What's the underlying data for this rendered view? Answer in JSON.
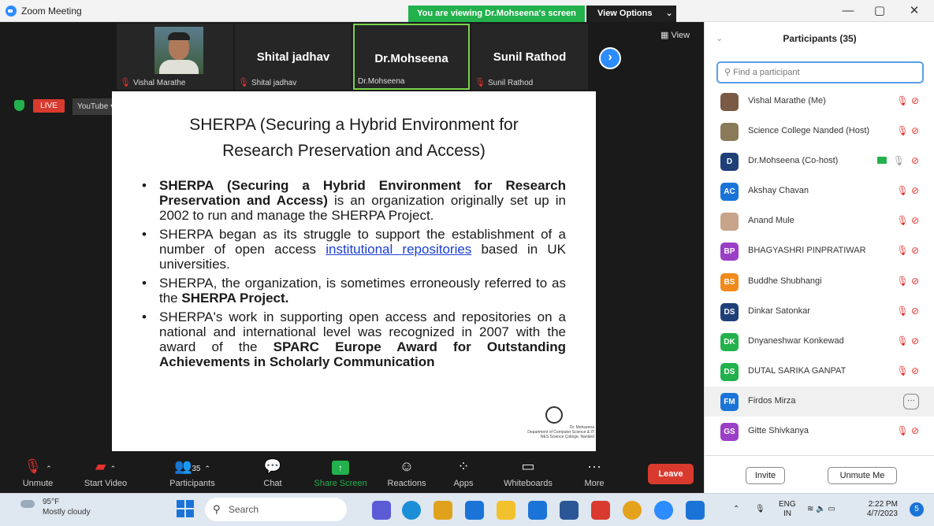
{
  "window": {
    "title": "Zoom Meeting",
    "minimize": "—",
    "maximize": "▢",
    "close": "✕"
  },
  "banner": {
    "viewing": "You are viewing Dr.Mohseena's screen",
    "view_options": "View Options"
  },
  "gallery": {
    "view_label": "View",
    "thumbs": [
      {
        "big_name": "",
        "label": "Vishal Marathe"
      },
      {
        "big_name": "Shital jadhav",
        "label": "Shital jadhav"
      },
      {
        "big_name": "Dr.Mohseena",
        "label": "Dr.Mohseena"
      },
      {
        "big_name": "Sunil Rathod",
        "label": "Sunil Rathod"
      }
    ]
  },
  "stream": {
    "live": "LIVE",
    "platform": "YouTube"
  },
  "slide": {
    "title_line1": "SHERPA (Securing a Hybrid Environment for",
    "title_line2": "Research Preservation and Access)",
    "b1_bold": "SHERPA (Securing a Hybrid Environment for Research Preservation and Access)",
    "b1_rest": " is an organization originally set up in 2002 to run and manage the SHERPA Project.",
    "b2_pre": "SHERPA began as its  struggle to support the establishment of a number of open access ",
    "b2_link": "institutional repositories",
    "b2_post": " based in UK universities.",
    "b3_pre": "SHERPA, the organization, is sometimes erroneously referred to as the ",
    "b3_bold": "SHERPA Project.",
    "b4_pre": "SHERPA's work in supporting open access and repositories on a national and international level was recognized in 2007 with the award of the ",
    "b4_bold": "SPARC Europe Award for Outstanding Achievements in Scholarly Communication",
    "credit_line1": "Dr. Mohseena",
    "credit_line2": "Department of Computer Science & IT",
    "credit_line3": "NES Science College, Nanded"
  },
  "toolbar": {
    "unmute": "Unmute",
    "start_video": "Start Video",
    "participants": "Participants",
    "participants_count": "35",
    "chat": "Chat",
    "share_screen": "Share Screen",
    "reactions": "Reactions",
    "apps": "Apps",
    "whiteboards": "Whiteboards",
    "more": "More",
    "leave": "Leave"
  },
  "panel": {
    "title": "Participants (35)",
    "search_placeholder": "Find a participant",
    "participants": [
      {
        "name": "Vishal Marathe (Me)",
        "initials": "",
        "color": "#7a5a44"
      },
      {
        "name": "Science College Nanded (Host)",
        "initials": "",
        "color": "#8a7a5a"
      },
      {
        "name": "Dr.Mohseena (Co-host)",
        "initials": "D",
        "color": "#1f3f78"
      },
      {
        "name": "Akshay Chavan",
        "initials": "AC",
        "color": "#1a74d8"
      },
      {
        "name": "Anand Mule",
        "initials": "",
        "color": "#c7a48a"
      },
      {
        "name": "BHAGYASHRI PINPRATIWAR",
        "initials": "BP",
        "color": "#9b3fc7"
      },
      {
        "name": "Buddhe Shubhangi",
        "initials": "BS",
        "color": "#f08a1c"
      },
      {
        "name": "Dinkar Satonkar",
        "initials": "DS",
        "color": "#1f3f78"
      },
      {
        "name": "Dnyaneshwar Konkewad",
        "initials": "DK",
        "color": "#22b14c"
      },
      {
        "name": "DUTAL SARIKA GANPAT",
        "initials": "DS",
        "color": "#22b14c"
      },
      {
        "name": "Firdos Mirza",
        "initials": "FM",
        "color": "#1a74d8"
      },
      {
        "name": "Gitte Shivkanya",
        "initials": "GS",
        "color": "#9b3fc7"
      }
    ],
    "invite": "Invite",
    "unmute_me": "Unmute Me"
  },
  "taskbar": {
    "temp": "95°F",
    "weather": "Mostly cloudy",
    "search": "Search",
    "lang1": "ENG",
    "lang2": "IN",
    "time": "2:22 PM",
    "date": "4/7/2023",
    "notifications": "5"
  }
}
